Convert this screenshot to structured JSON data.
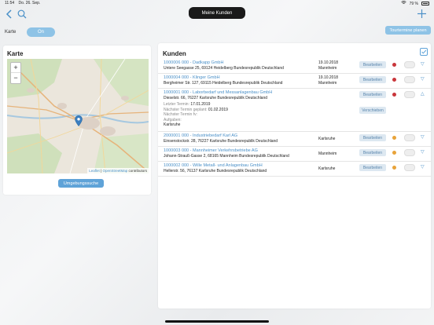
{
  "status_bar": {
    "time": "11:54",
    "date": "Do. 26. Sep.",
    "battery": "79 %"
  },
  "nav": {
    "title": "Meine Kunden"
  },
  "top_controls": {
    "karte_label": "Karte",
    "toggle_label": "On",
    "tour_button": "Tourtermine planen"
  },
  "map_panel": {
    "title": "Karte",
    "zoom_in": "+",
    "zoom_out": "−",
    "attribution_leaflet": "Leaflet",
    "attribution_sep": "|",
    "attribution_osm": "OpenStreetMap",
    "attribution_contrib": "contributors",
    "button": "Umgebungssuche"
  },
  "kunden": {
    "title": "Kunden",
    "edit_label": "Bearbeiten",
    "verschieben_label": "Verschieben",
    "rows": [
      {
        "name": "1000006 000 - Dadkapp GmbH",
        "address": "Untere Seegasse 25, 69124 Heidelberg Bundesrepublik Deutschland",
        "date": "19.10.2018",
        "city": "Mannheim",
        "status_color": "#c9363b",
        "chevron": "▽"
      },
      {
        "name": "1000004 000 - Klinger GmbH",
        "address": "Bergheimer Str. 127, 69115 Heidelberg Bundesrepublik Deutschland",
        "date": "19.10.2018",
        "city": "Mannheim",
        "status_color": "#c9363b",
        "chevron": "▽"
      },
      {
        "name": "1000001 000 - Laborbedarf und Messanlagenbau GmbH",
        "address": "Dieselstr. 66, 76227 Karlsruhe Bundesrepublik Deutschland",
        "date": "",
        "city": "",
        "status_color": "#c9363b",
        "chevron": "△",
        "details": [
          {
            "label": "Letzter Termin:",
            "value": "17.01.2019"
          },
          {
            "label": "Nächster Termin geplant:",
            "value": "01.02.2019"
          },
          {
            "label": "Nächster Termin fv:",
            "value": ""
          },
          {
            "label": "Aufgaben:",
            "value": ""
          },
          {
            "label": "",
            "value": "Karlsruhe"
          }
        ]
      },
      {
        "name": "2000001 000 - Industriebedarf Karl AG",
        "address": "Einsenstockstr. 28, 76227 Karlsruhe Bundesrepublik Deutschland",
        "date": "",
        "city": "Karlsruhe",
        "status_color": "#e8a33a",
        "chevron": "▽"
      },
      {
        "name": "1000003 000 - Mannheimer Verkehrsbetriebe AG",
        "address": "Johann-Strauß-Gasse 2, 68165 Mannheim Bundesrepublik Deutschland",
        "date": "",
        "city": "Mannheim",
        "status_color": "#e8a33a",
        "chevron": "▽"
      },
      {
        "name": "1000002 000 - Wille Metall- und Anlagenbau GmbH",
        "address": "Hellerstr. 56, 76137 Karlsruhe Bundesrepublik Deutschland",
        "date": "",
        "city": "Karlsruhe",
        "status_color": "#e8a33a",
        "chevron": "▽"
      }
    ]
  },
  "colors": {
    "accent": "#4a90c8",
    "toggle": "#8ec3e6"
  }
}
